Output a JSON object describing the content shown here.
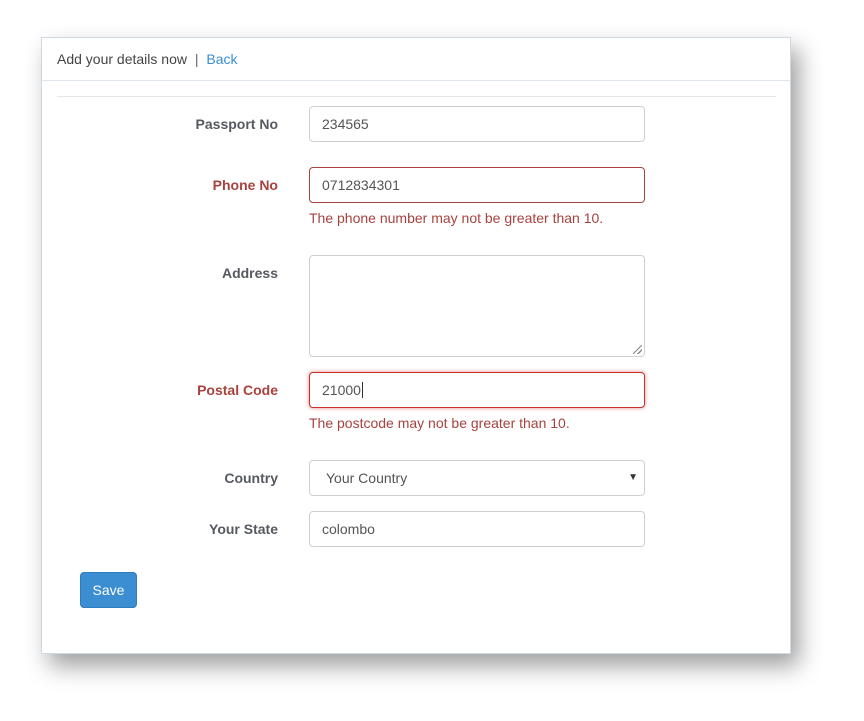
{
  "header": {
    "title": "Add your details now",
    "separator": "|",
    "back_link": "Back"
  },
  "form": {
    "passport": {
      "label": "Passport No",
      "value": "234565"
    },
    "phone": {
      "label": "Phone No",
      "value": "0712834301",
      "error": "The phone number may not be greater than 10."
    },
    "address": {
      "label": "Address",
      "value": ""
    },
    "postal": {
      "label": "Postal Code",
      "value": "21000",
      "error": "The postcode may not be greater than 10."
    },
    "country": {
      "label": "Country",
      "selected": "Your Country",
      "arrow_icon": "caret-down-icon"
    },
    "state": {
      "label": "Your State",
      "value": "colombo"
    },
    "save_label": "Save"
  },
  "colors": {
    "primary": "#3a8ed1",
    "error": "#a8423f",
    "label": "#555a60"
  }
}
